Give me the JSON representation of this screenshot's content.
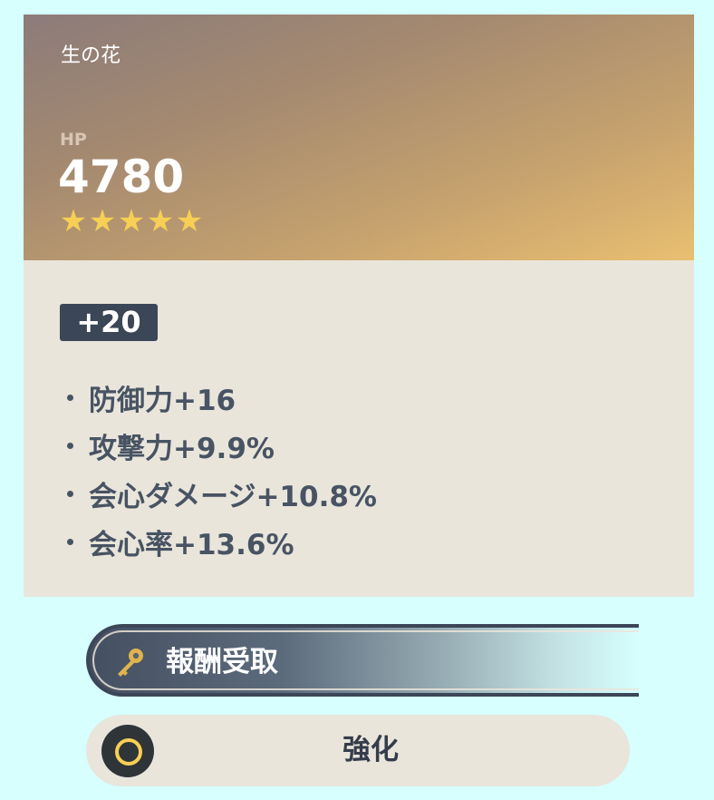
{
  "artifact": {
    "slot_name": "生の花",
    "main_stat": {
      "label": "HP",
      "value": "4780"
    },
    "rarity_stars": 5,
    "star_glyph": "★",
    "level": "+20",
    "substats": [
      "防御力+16",
      "攻撃力+9.9%",
      "会心ダメージ+10.8%",
      "会心率+13.6%"
    ]
  },
  "actions": {
    "reward_label": "報酬受取",
    "reward_icon": "key-icon",
    "enhance_label": "強化",
    "enhance_icon": "ring-icon"
  },
  "colors": {
    "page_background": "#d6fffe",
    "header_gradient_start": "#8c7b7a",
    "header_gradient_end": "#e9bf71",
    "body_background": "#e9e5db",
    "badge_background": "#3b4656",
    "star": "#f6cf54",
    "text_dark": "#485363"
  }
}
